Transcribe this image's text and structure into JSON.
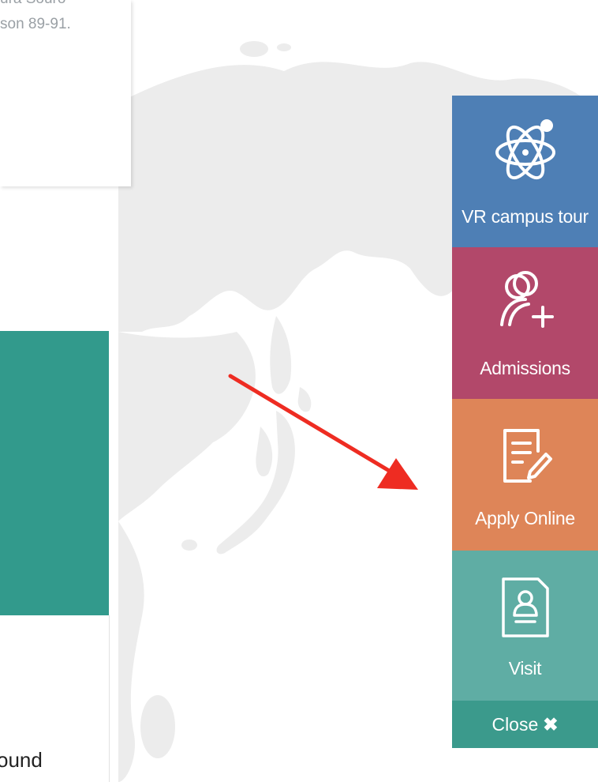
{
  "top_card": {
    "line1": "ura Souro",
    "line2": "son 89-91."
  },
  "bottom_card": {
    "word": "ound"
  },
  "sidebar": {
    "items": [
      {
        "label": "VR campus tour",
        "icon": "atom-icon",
        "color": "#4e7fb5"
      },
      {
        "label": "Admissions",
        "icon": "add-user-icon",
        "color": "#b2486a"
      },
      {
        "label": "Apply Online",
        "icon": "edit-document-icon",
        "color": "#de8558"
      },
      {
        "label": "Visit",
        "icon": "visitor-badge-icon",
        "color": "#5fada4"
      }
    ],
    "close": {
      "label": "Close",
      "icon": "close-icon",
      "color": "#3b9a8c"
    }
  },
  "colors": {
    "map": "#ececec",
    "teal_block": "#329a8c",
    "arrow": "#ee2c22"
  }
}
